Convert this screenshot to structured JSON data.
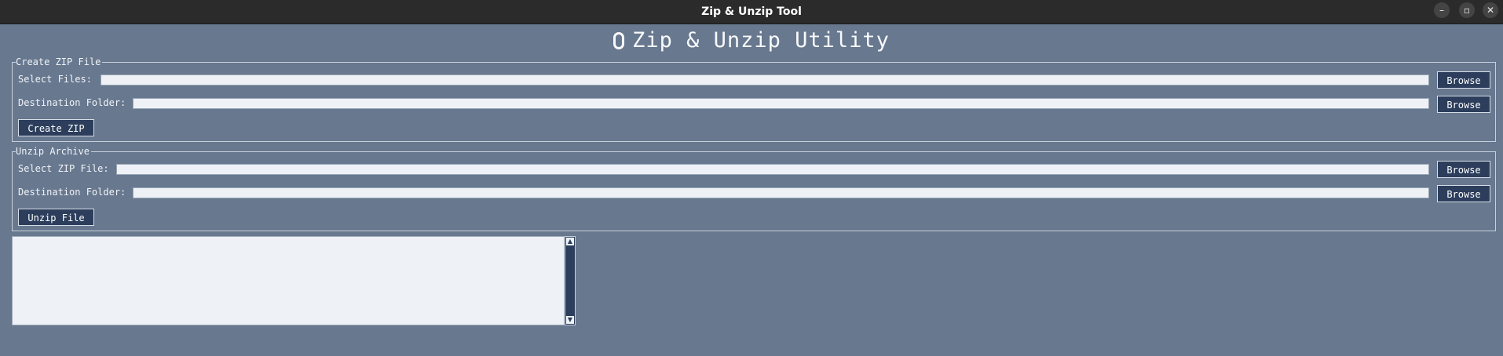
{
  "window": {
    "title": "Zip & Unzip Tool",
    "minimize_glyph": "–",
    "maximize_glyph": "▫",
    "close_glyph": "✕"
  },
  "app": {
    "title": "Zip & Unzip Utility"
  },
  "create_zip": {
    "legend": "Create ZIP File",
    "select_files_label": "Select Files:",
    "select_files_value": "",
    "destination_label": "Destination Folder:",
    "destination_value": "",
    "browse_label": "Browse",
    "action_label": "Create ZIP"
  },
  "unzip": {
    "legend": "Unzip Archive",
    "select_zip_label": "Select ZIP File:",
    "select_zip_value": "",
    "destination_label": "Destination Folder:",
    "destination_value": "",
    "browse_label": "Browse",
    "action_label": "Unzip File"
  },
  "log": {
    "content": ""
  },
  "scrollbar": {
    "up_glyph": "▲",
    "down_glyph": "▼"
  },
  "colors": {
    "background": "#67788f",
    "button": "#2c3e5c",
    "entry": "#eef2f7",
    "titlebar": "#2b2b2b"
  },
  "icons": {
    "app_title_icon": "zip-icon",
    "minimize": "minimize-icon",
    "maximize": "maximize-icon",
    "close": "close-icon"
  }
}
